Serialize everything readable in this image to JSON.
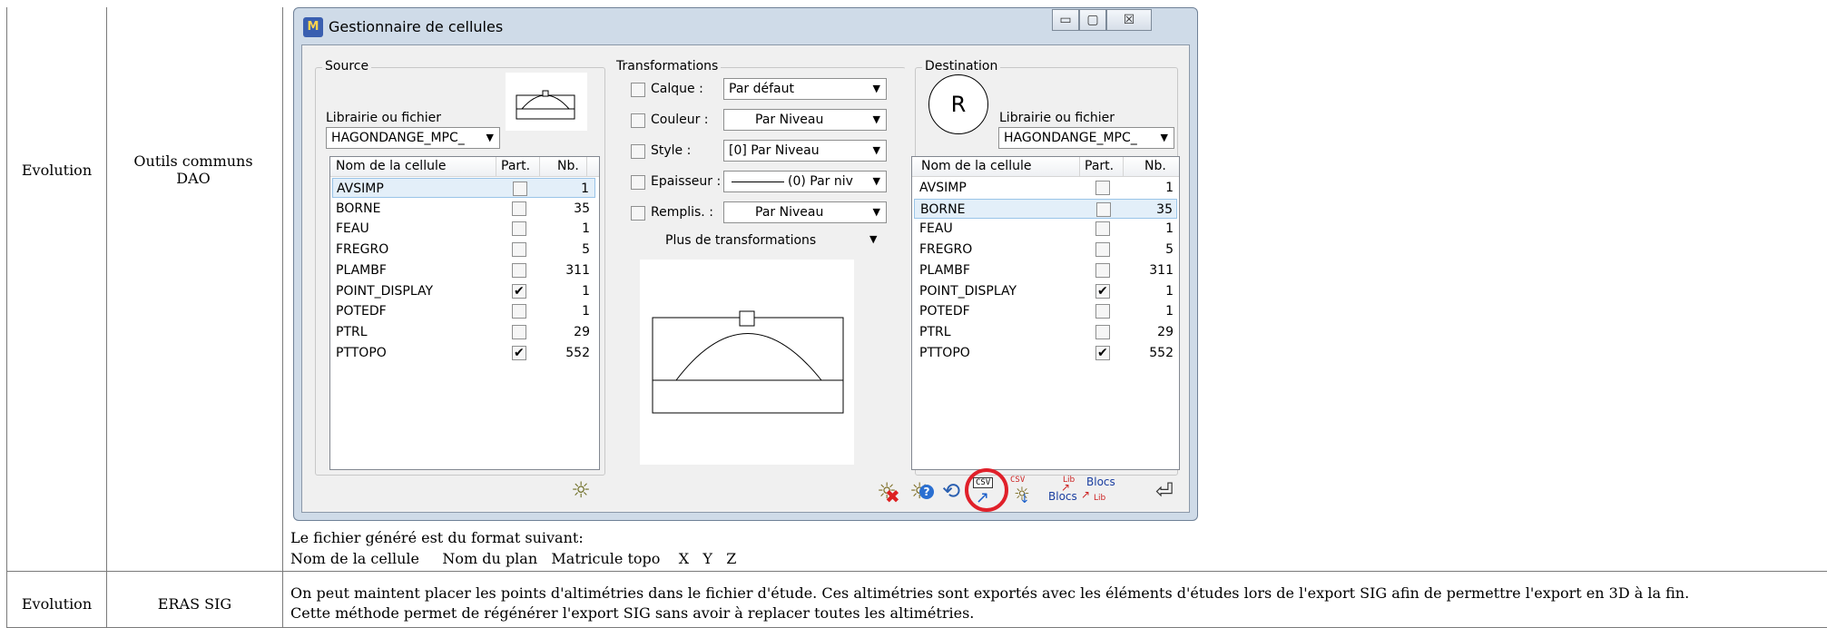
{
  "rows": [
    {
      "type": "Evolution",
      "module": "Outils communs DAO"
    },
    {
      "type": "Evolution",
      "module": "ERAS SIG"
    }
  ],
  "dialog": {
    "title": "Gestionnaire de cellules",
    "window_buttons": {
      "minimize": "▭",
      "maximize": "▢",
      "close": "☒"
    },
    "source": {
      "group_label": "Source",
      "lib_label": "Librairie ou fichier",
      "lib_value": "HAGONDANGE_MPC_",
      "columns": [
        "Nom de la cellule",
        "Part.",
        "Nb."
      ],
      "items": [
        {
          "name": "AVSIMP",
          "part": false,
          "nb": "1"
        },
        {
          "name": "BORNE",
          "part": false,
          "nb": "35"
        },
        {
          "name": "FEAU",
          "part": false,
          "nb": "1"
        },
        {
          "name": "FREGRO",
          "part": false,
          "nb": "5"
        },
        {
          "name": "PLAMBF",
          "part": false,
          "nb": "311"
        },
        {
          "name": "POINT_DISPLAY",
          "part": true,
          "nb": "1"
        },
        {
          "name": "POTEDF",
          "part": false,
          "nb": "1"
        },
        {
          "name": "PTRL",
          "part": false,
          "nb": "29"
        },
        {
          "name": "PTTOPO",
          "part": true,
          "nb": "552"
        }
      ],
      "selected_index": 0
    },
    "transformations": {
      "group_label": "Transformations",
      "calque_label": "Calque :",
      "calque_value": "Par défaut",
      "couleur_label": "Couleur :",
      "couleur_value": "Par Niveau",
      "style_label": "Style :",
      "style_value": "[0] Par Niveau",
      "epaisseur_label": "Epaisseur :",
      "epaisseur_value": "(0) Par niv",
      "remplis_label": "Remplis. :",
      "remplis_value": "Par Niveau",
      "more_label": "Plus de transformations"
    },
    "destination": {
      "group_label": "Destination",
      "preview_letter": "R",
      "lib_label": "Librairie ou fichier",
      "lib_value": "HAGONDANGE_MPC_",
      "columns": [
        "Nom de la cellule",
        "Part.",
        "Nb."
      ],
      "items": [
        {
          "name": "AVSIMP",
          "part": false,
          "nb": "1"
        },
        {
          "name": "BORNE",
          "part": false,
          "nb": "35"
        },
        {
          "name": "FEAU",
          "part": false,
          "nb": "1"
        },
        {
          "name": "FREGRO",
          "part": false,
          "nb": "5"
        },
        {
          "name": "PLAMBF",
          "part": false,
          "nb": "311"
        },
        {
          "name": "POINT_DISPLAY",
          "part": true,
          "nb": "1"
        },
        {
          "name": "POTEDF",
          "part": false,
          "nb": "1"
        },
        {
          "name": "PTRL",
          "part": false,
          "nb": "29"
        },
        {
          "name": "PTTOPO",
          "part": true,
          "nb": "552"
        }
      ],
      "selected_index": 1
    },
    "toolbar": {
      "csv_label": "CSV",
      "csv2_label": "CSV",
      "blocs_lib_label": "Blocs",
      "lib_small": "Lib",
      "lib_blocs_label": "Blocs",
      "lib_small2": "Lib"
    }
  },
  "notes": {
    "line1": "Le fichier généré est du format suivant:",
    "line2": "Nom de la cellule     Nom du plan   Matricule topo    X   Y   Z",
    "line3": "On peut maintent placer les points d'altimétries dans le fichier d'étude. Ces altimétries sont exportés avec les éléments d'études lors de l'export SIG afin de permettre l'export en 3D à la fin.",
    "line4": "Cette méthode permet de régénérer l'export SIG sans avoir à replacer toutes les altimétries."
  },
  "colors": {
    "highlight_circle": "#e0202a",
    "selection": "#e3eff9"
  }
}
